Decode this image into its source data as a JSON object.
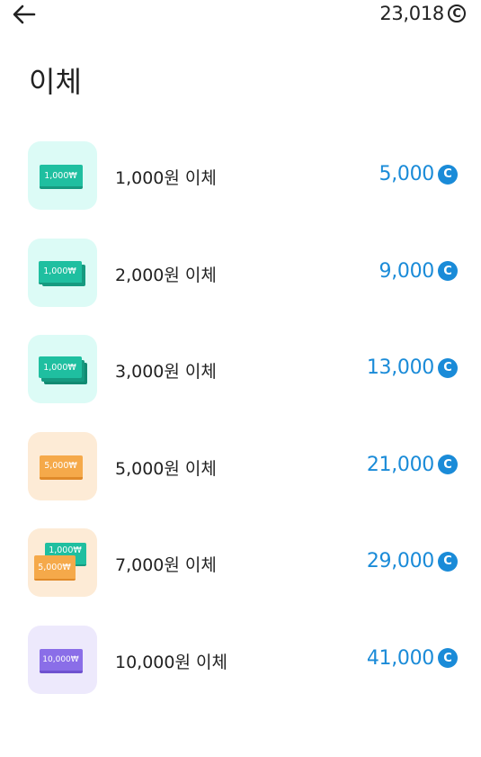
{
  "header": {
    "balance": "23,018",
    "balance_coin_glyph": "C"
  },
  "page_title": "이체",
  "items": [
    {
      "label": "1,000원 이체",
      "price": "5,000",
      "coin_glyph": "C",
      "note_text": "1,000₩",
      "note_color": "#1fbfa0",
      "bg_color": "#dcfbf6",
      "icon": "single-green-bill-icon"
    },
    {
      "label": "2,000원 이체",
      "price": "9,000",
      "coin_glyph": "C",
      "note_text": "1,000₩",
      "note_color": "#1fbfa0",
      "bg_color": "#dcfbf6",
      "icon": "double-green-bill-icon"
    },
    {
      "label": "3,000원 이체",
      "price": "13,000",
      "coin_glyph": "C",
      "note_text": "1,000₩",
      "note_color": "#1fbfa0",
      "bg_color": "#dcfbf6",
      "icon": "triple-green-bill-icon"
    },
    {
      "label": "5,000원 이체",
      "price": "21,000",
      "coin_glyph": "C",
      "note_text": "5,000₩",
      "note_color": "#f5a94a",
      "bg_color": "#fdebd6",
      "icon": "orange-bill-icon"
    },
    {
      "label": "7,000원 이체",
      "price": "29,000",
      "coin_glyph": "C",
      "note_text": "5,000₩",
      "note_back_text": "1,000₩",
      "note_color": "#f5a94a",
      "bg_color": "#fdebd6",
      "icon": "mixed-bills-icon"
    },
    {
      "label": "10,000원 이체",
      "price": "41,000",
      "coin_glyph": "C",
      "note_text": "10,000₩",
      "note_color": "#8a6ee8",
      "bg_color": "#ede9fc",
      "icon": "purple-bill-icon"
    }
  ]
}
